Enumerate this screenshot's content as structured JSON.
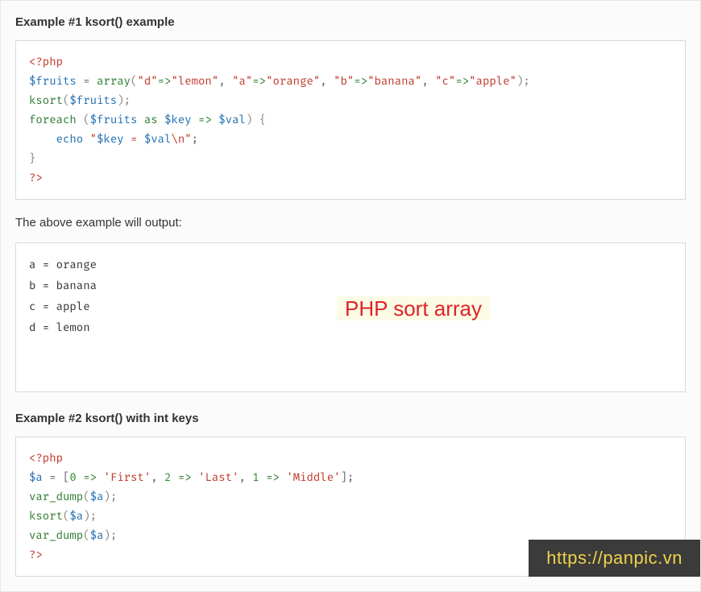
{
  "example1": {
    "heading_prefix": "Example #1 ",
    "heading_func": "ksort()",
    "heading_suffix": " example",
    "code": {
      "l1_open": "<?php",
      "l2_var": "$fruits",
      "l2_eq": " = ",
      "l2_fn": "array",
      "l2_p1": "(",
      "l2_s1": "\"d\"",
      "l2_ar": "=>",
      "l2_s2": "\"lemon\"",
      "l2_c": ", ",
      "l2_s3": "\"a\"",
      "l2_s4": "\"orange\"",
      "l2_s5": "\"b\"",
      "l2_s6": "\"banana\"",
      "l2_s7": "\"c\"",
      "l2_s8": "\"apple\"",
      "l2_p2": ");",
      "l3_fn": "ksort",
      "l3_p1": "(",
      "l3_var": "$fruits",
      "l3_p2": ");",
      "l4_kw": "foreach",
      "l4_p1": " (",
      "l4_var1": "$fruits",
      "l4_as": " as ",
      "l4_var2": "$key",
      "l4_ar": " => ",
      "l4_var3": "$val",
      "l4_p2": ") {",
      "l5_indent": "    ",
      "l5_echo": "echo",
      "l5_sp": " ",
      "l5_q1": "\"",
      "l5_v1": "$key",
      "l5_mid": " = ",
      "l5_v2": "$val",
      "l5_nl": "\\n",
      "l5_q2": "\"",
      "l5_end": ";",
      "l6": "}",
      "l7_close": "?>"
    }
  },
  "output_note": "The above example will output:",
  "output_lines": {
    "l1": "a = orange",
    "l2": "b = banana",
    "l3": "c = apple",
    "l4": "d = lemon"
  },
  "annotation": "PHP sort array",
  "example2": {
    "heading_prefix": "Example #2 ",
    "heading_func": "ksort()",
    "heading_suffix": " with int keys",
    "code": {
      "l1_open": "<?php",
      "l2_var": "$a",
      "l2_eq": " = [",
      "l2_n0": "0",
      "l2_ar": " => ",
      "l2_s1": "'First'",
      "l2_c": ", ",
      "l2_n2": "2",
      "l2_s2": "'Last'",
      "l2_n1": "1",
      "l2_s3": "'Middle'",
      "l2_end": "];",
      "l3_fn": "var_dump",
      "l3_p1": "(",
      "l3_var": "$a",
      "l3_p2": ");",
      "l4_fn": "ksort",
      "l4_p1": "(",
      "l4_var": "$a",
      "l4_p2": ");",
      "l5_fn": "var_dump",
      "l5_p1": "(",
      "l5_var": "$a",
      "l5_p2": ");",
      "l6_close": "?>"
    }
  },
  "watermark": "https://panpic.vn"
}
